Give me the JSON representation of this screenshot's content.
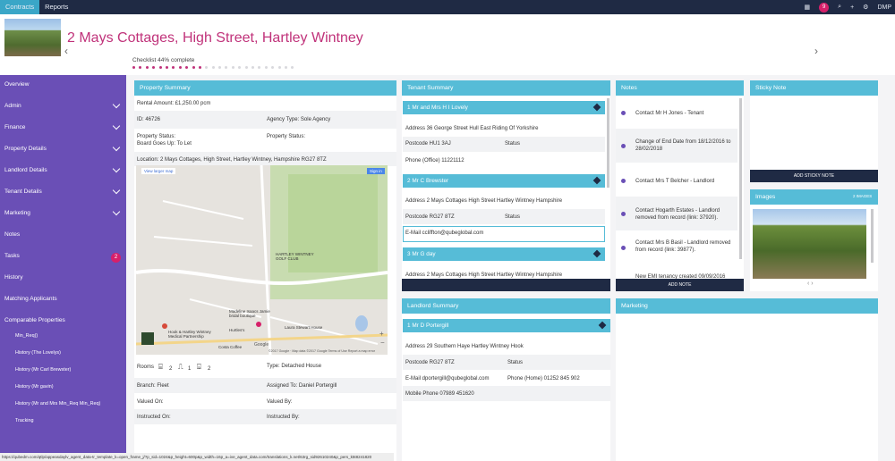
{
  "topbar": {
    "tabs": [
      "Contracts",
      "Reports"
    ],
    "notif_count": "9",
    "user": "DMP"
  },
  "header": {
    "title": "2 Mays Cottages, High Street, Hartley Wintney",
    "checklist": "Checklist 44% complete",
    "checklist_progress": 0.44
  },
  "sidebar": {
    "items": [
      "Overview",
      "Admin",
      "Finance",
      "Property Details",
      "Landlord Details",
      "Tenant Details",
      "Marketing",
      "Notes",
      "Tasks",
      "History",
      "Matching Applicants",
      "Comparable Properties"
    ],
    "tasks_badge": "2",
    "comparable": [
      "Min_Req()",
      "History (The Lovelys)",
      "History (Mr Carl Brewster)",
      "History (Mr gavin)",
      "History (Mr and Mrs Min_Req Min_Req)",
      "Tracking"
    ]
  },
  "property": {
    "heading": "Property Summary",
    "rental": "Rental Amount: £1,250.00 pcm",
    "id": "ID: 46726",
    "agency": "Agency Type: Sole Agency",
    "status1": "Property Status:",
    "status1b": "Board Goes Up: To Let",
    "status2": "Property Status:",
    "location": "Location: 2 Mays Cottages, High Street, Hartley Wintney, Hampshire RG27 8TZ",
    "map_link": "View larger map",
    "map_signin": "Sign in",
    "map_labels": [
      "HARTLEY WINTNEY GOLF CLUB",
      "Madeline Isaacs Jamie bridal boutique",
      "Hook & Hartley Wintney Medical Partnership",
      "Hurtles's",
      "Laura Stewart House",
      "Costa Coffee",
      "Google"
    ],
    "map_footer": "©2017 Google · Map data ©2017 Google   Terms of Use   Report a map error",
    "rooms": "Rooms",
    "rooms_counts": [
      "2",
      "1",
      "2"
    ],
    "type": "Type: Detached House",
    "branch": "Branch: Fleet",
    "assigned": "Assigned To: Daniel Portergill",
    "valued_on": "Valued On:",
    "valued_by": "Valued By:",
    "instructed_on": "Instructed On:",
    "instructed_by": "Instructed By:"
  },
  "tenant": {
    "heading": "Tenant Summary",
    "tenants": [
      {
        "name": "1 Mr and Mrs H I Lovely",
        "address": "Address 36 George Street Hull East Riding Of Yorkshire",
        "postcode": "Postcode HU1 3AJ",
        "status": "Status",
        "phone": "Phone (Office) 11221112"
      },
      {
        "name": "2 Mr C Brewster",
        "address": "Address 2 Mays Cottages High Street Hartley Wintney Hampshire",
        "postcode": "Postcode RG27 8TZ",
        "status": "Status",
        "email": "E-Mail ccliffton@qubeglobal.com"
      },
      {
        "name": "3 Mr G day",
        "address": "Address 2 Mays Cottages High Street Hartley Wintney Hampshire"
      }
    ]
  },
  "landlord": {
    "heading": "Landlord Summary",
    "name": "1 Mr D Portergill",
    "address": "Address 29 Southern Haye Hartley Wintney Hook",
    "postcode": "Postcode RG27 8TZ",
    "status": "Status",
    "email": "E-Mail dportergill@qubeglobal.com",
    "phone_home": "Phone (Home) 01252 845 902",
    "mobile": "Mobile Phone 07989 451620"
  },
  "notes": {
    "heading": "Notes",
    "items": [
      "Contact Mr H Jones - Tenant",
      "Change of End Date from 18/12/2016 to 28/02/2018",
      "Contact Mrs T Belcher - Landlord",
      "Contact Hogarth Estates - Landlord removed from record (link: 37920).",
      "Contact Mrs B Basil - Landlord removed from record (link: 39877).",
      "New EMI tenancy created 09/09/2016"
    ],
    "add_label": "ADD NOTE"
  },
  "sticky": {
    "heading": "Sticky Note",
    "add_label": "ADD STICKY NOTE"
  },
  "images": {
    "heading": "Images",
    "count": "2 IMAGES"
  },
  "marketing": {
    "heading": "Marketing"
  },
  "statusbar": "https://qubedm.com/qtlp/appeasdaylv_agent_data-tr_template_k=open_frame_j/?p_sid=1024&p_height=600p&p_width=16p_a=ive_agent_data.com/translations_k.net/63rg_sid92610240&p_pers_k5t8241820"
}
